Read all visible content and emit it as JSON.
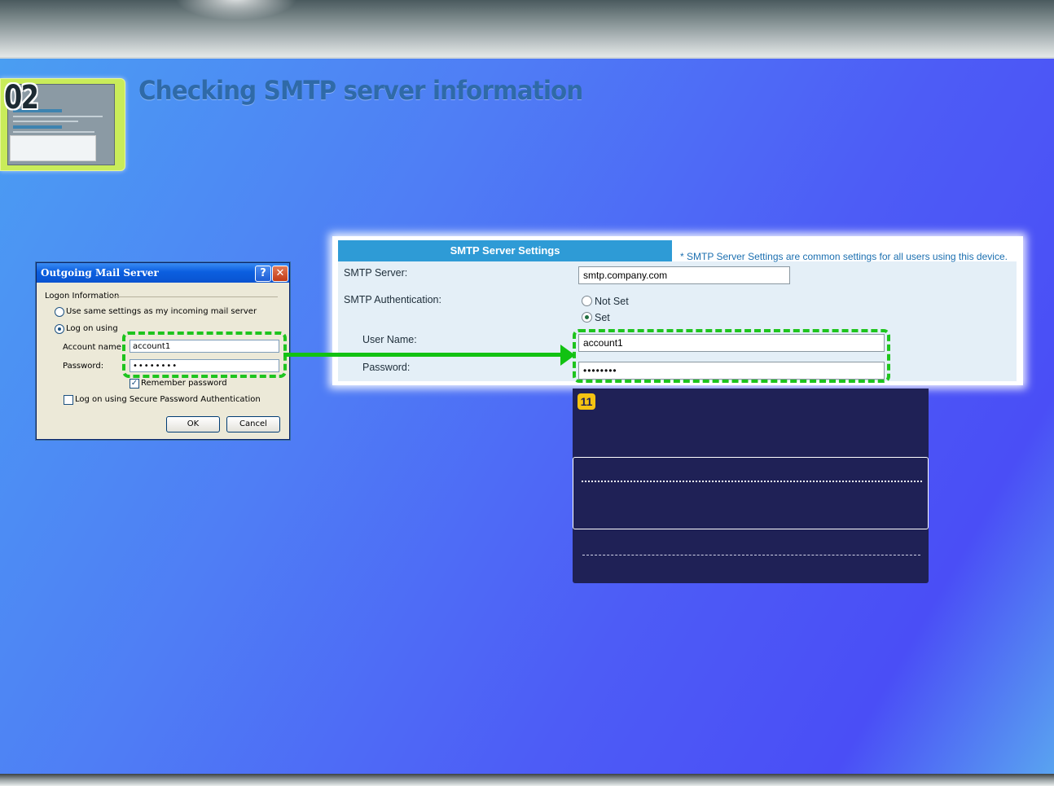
{
  "page": {
    "step_number": "02",
    "title": "Checking SMTP server information"
  },
  "dialog": {
    "title": "Outgoing Mail Server",
    "help_glyph": "?",
    "close_glyph": "✕",
    "group_label": "Logon Information",
    "option_same": "Use same settings as my incoming mail server",
    "option_logon": "Log on using",
    "account_label": "Account name:",
    "account_value": "account1",
    "password_label": "Password:",
    "password_value": "••••••••",
    "remember_label": "Remember password",
    "remember_checked": true,
    "spa_label": "Log on using Secure Password Authentication",
    "spa_checked": false,
    "ok_label": "OK",
    "cancel_label": "Cancel",
    "selected_option": "logon"
  },
  "smtp_settings": {
    "header": "SMTP Server Settings",
    "note": "* SMTP Server Settings are common settings for all users using this device.",
    "server_label": "SMTP Server:",
    "server_value": "smtp.company.com",
    "auth_label": "SMTP Authentication:",
    "auth_not_set": "Not Set",
    "auth_set": "Set",
    "auth_selected": "Set",
    "username_label": "User Name:",
    "username_value": "account1",
    "password_label": "Password:",
    "password_value": "••••••••"
  },
  "info_panel": {
    "badge": "11"
  },
  "colors": {
    "highlight": "#1ec41e",
    "header_blue": "#2e9bd6",
    "dark_panel": "#1f2156",
    "badge": "#f5c312"
  }
}
